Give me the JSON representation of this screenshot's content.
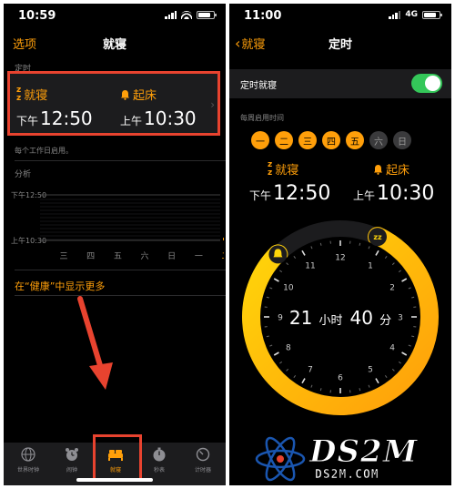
{
  "left": {
    "status": {
      "time": "10:59"
    },
    "nav": {
      "left": "选项",
      "title": "就寝"
    },
    "schedule_label": "定时",
    "bedtime": {
      "label": "就寝",
      "ampm": "下午",
      "time": "12:50"
    },
    "wake": {
      "label": "起床",
      "ampm": "上午",
      "time": "10:30"
    },
    "note": "每个工作日启用。",
    "analysis_label": "分析",
    "chart_data": {
      "type": "bar",
      "categories": [
        "三",
        "四",
        "五",
        "六",
        "日",
        "一",
        "二"
      ],
      "y_ticks": [
        "下午12:50",
        "上午10:30"
      ],
      "values": [
        0,
        0,
        0,
        0,
        0,
        0,
        1
      ],
      "ylim": [
        0,
        1
      ],
      "highlight_category": "二",
      "grid": true,
      "highlight_color": "#ff9f0a"
    },
    "health_link": "在“健康”中显示更多",
    "tabs": [
      {
        "label": "世界时钟",
        "icon": "globe-icon"
      },
      {
        "label": "闹钟",
        "icon": "alarm-clock-icon"
      },
      {
        "label": "就寝",
        "icon": "bed-icon"
      },
      {
        "label": "秒表",
        "icon": "stopwatch-icon"
      },
      {
        "label": "计时器",
        "icon": "timer-icon"
      }
    ]
  },
  "right": {
    "status": {
      "time": "11:00",
      "network": "4G"
    },
    "nav": {
      "back": "就寝",
      "title": "定时"
    },
    "toggle_label": "定时就寝",
    "toggle_on": true,
    "weekdays_label": "每周启用时间",
    "days": [
      {
        "label": "一",
        "on": true
      },
      {
        "label": "二",
        "on": true
      },
      {
        "label": "三",
        "on": true
      },
      {
        "label": "四",
        "on": true
      },
      {
        "label": "五",
        "on": true
      },
      {
        "label": "六",
        "on": false
      },
      {
        "label": "日",
        "on": false
      }
    ],
    "bedtime": {
      "label": "就寝",
      "ampm": "下午",
      "time": "12:50"
    },
    "wake": {
      "label": "起床",
      "ampm": "上午",
      "time": "10:30"
    },
    "duration": {
      "hours": "21",
      "hours_unit": "小时",
      "minutes": "40",
      "minutes_unit": "分"
    },
    "dial_numbers": [
      "12",
      "1",
      "2",
      "3",
      "4",
      "5",
      "6",
      "7",
      "8",
      "9",
      "10",
      "11"
    ]
  },
  "watermark": {
    "big": "DS2M",
    "small": "DS2M.COM"
  },
  "colors": {
    "accent": "#ff9f0a",
    "annotation": "#e8432f",
    "switch_on": "#34c759"
  }
}
